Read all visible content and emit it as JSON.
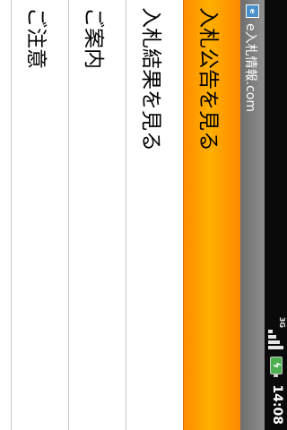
{
  "statusbar": {
    "network_type": "3G",
    "clock": "14:08",
    "signal_bars": 4,
    "battery_charging": true
  },
  "titlebar": {
    "icon_text": "e",
    "title": "e入札情報.com"
  },
  "menu": {
    "items": [
      {
        "label": "入札公告を見る",
        "selected": true
      },
      {
        "label": "入札結果を見る",
        "selected": false
      },
      {
        "label": "ご案内",
        "selected": false
      },
      {
        "label": "ご注意",
        "selected": false
      }
    ]
  },
  "colors": {
    "highlight": "#ff9900",
    "titlebar": "#7f7f7f",
    "statusbar": "#0a0a0a"
  }
}
